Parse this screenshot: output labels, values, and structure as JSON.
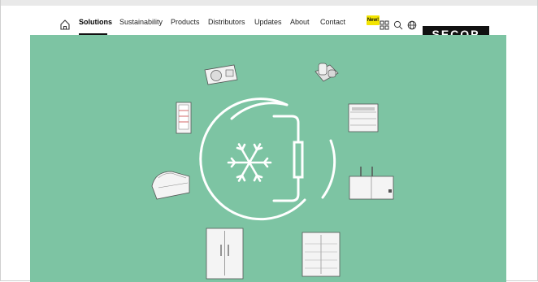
{
  "nav": {
    "items": [
      {
        "label": "Solutions",
        "active": true
      },
      {
        "label": "Sustainability",
        "active": false
      },
      {
        "label": "Products",
        "active": false
      },
      {
        "label": "Distributors",
        "active": false
      },
      {
        "label": "Updates",
        "active": false
      },
      {
        "label": "About",
        "active": false
      },
      {
        "label": "Contact",
        "active": false
      }
    ],
    "new_badge": "New!",
    "icons": [
      "home-icon",
      "grid-icon",
      "search-icon",
      "globe-icon"
    ]
  },
  "brand": {
    "logo_text": "SECOP"
  },
  "colors": {
    "hero_bg": "#7dc4a3",
    "accent_badge": "#f3e400",
    "logo_bg": "#111111"
  }
}
